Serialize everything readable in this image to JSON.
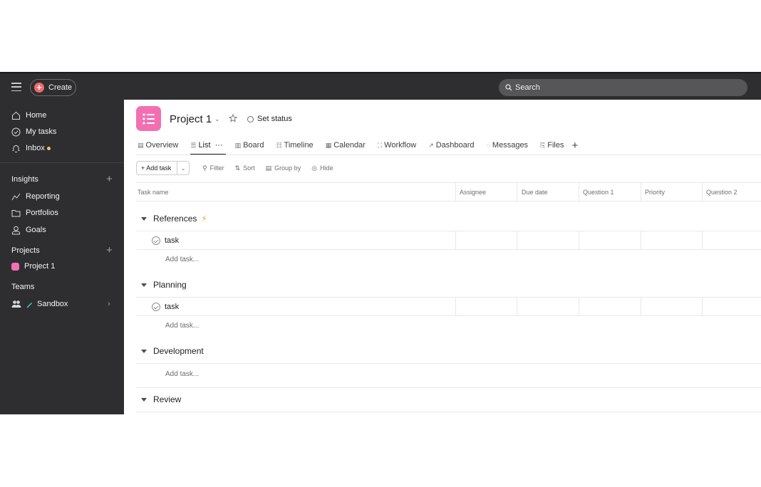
{
  "topbar": {
    "create_label": "Create",
    "search_placeholder": "Search"
  },
  "sidebar": {
    "nav": [
      {
        "label": "Home",
        "icon": "home-icon"
      },
      {
        "label": "My tasks",
        "icon": "check-circle-icon"
      },
      {
        "label": "Inbox",
        "icon": "bell-icon"
      }
    ],
    "insights_label": "Insights",
    "insights_items": [
      {
        "label": "Reporting",
        "icon": "chart-line-icon"
      },
      {
        "label": "Portfolios",
        "icon": "folder-icon"
      },
      {
        "label": "Goals",
        "icon": "person-icon"
      }
    ],
    "projects_label": "Projects",
    "projects": [
      {
        "label": "Project 1",
        "color": "#f26fb2"
      }
    ],
    "teams_label": "Teams",
    "teams": [
      {
        "label": "Sandbox"
      }
    ]
  },
  "project": {
    "title": "Project 1",
    "set_status": "Set status",
    "color": "#f26fb2"
  },
  "tabs": [
    {
      "label": "Overview",
      "glyph": "▤"
    },
    {
      "label": "List",
      "glyph": "☰",
      "active": true
    },
    {
      "label": "Board",
      "glyph": "▥"
    },
    {
      "label": "Timeline",
      "glyph": "☷"
    },
    {
      "label": "Calendar",
      "glyph": "▦"
    },
    {
      "label": "Workflow",
      "glyph": "⛶"
    },
    {
      "label": "Dashboard",
      "glyph": "↗"
    },
    {
      "label": "Messages",
      "glyph": "◌"
    },
    {
      "label": "Files",
      "glyph": "⎘"
    }
  ],
  "toolbar": {
    "add_task": "+ Add task",
    "filter": "Filter",
    "sort": "Sort",
    "group_by": "Group by",
    "hide": "Hide"
  },
  "columns": [
    "Task name",
    "Assignee",
    "Due date",
    "Question 1",
    "Priority",
    "Question 2"
  ],
  "sections": [
    {
      "title": "References",
      "tasks": [
        "task"
      ],
      "add_task": "Add task..."
    },
    {
      "title": "Planning",
      "tasks": [
        "task"
      ],
      "add_task": "Add task..."
    },
    {
      "title": "Development",
      "tasks": [],
      "add_task": "Add task..."
    },
    {
      "title": "Review",
      "tasks": []
    }
  ],
  "colors": {
    "sidebar_bg": "#2e2e30",
    "accent_create": "#f06a6a",
    "inbox_dot": "#f1bd6c"
  }
}
